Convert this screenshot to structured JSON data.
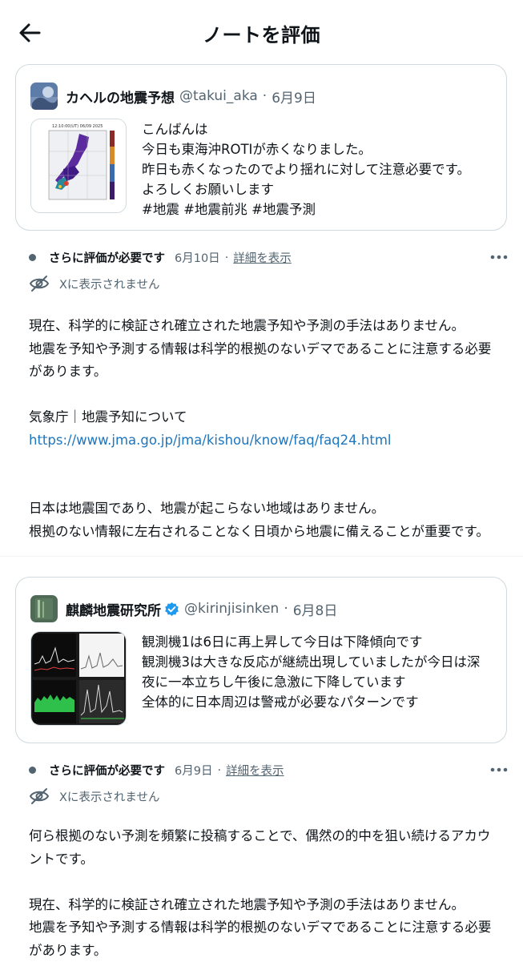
{
  "header": {
    "title": "ノートを評価"
  },
  "items": [
    {
      "tweet": {
        "name": "カヘルの地震予想",
        "handle": "@takui_aka",
        "date": "6月9日",
        "lines": [
          "こんばんは",
          "今日も東海沖ROTIが赤くなりました。",
          "昨日も赤くなったのでより揺れに対して注意必要です。",
          "よろしくお願いします",
          "#地震 #地震前兆 #地震予測"
        ],
        "thumb_lines": [
          "12:10:00(UT) 06/09 2025"
        ]
      },
      "note": {
        "status": "さらに評価が必要です",
        "date": "6月10日",
        "separator": "·",
        "details": "詳細を表示",
        "not_shown": "Xに表示されません",
        "body": [
          "現在、科学的に検証され確立された地震予知や予測の手法はありません。",
          "地震を予知や予測する情報は科学的根拠のないデマであることに注意する必要",
          "があります。",
          "",
          "気象庁｜地震予知について"
        ],
        "link": "https://www.jma.go.jp/jma/kishou/know/faq/faq24.html",
        "body2": [
          "日本は地震国であり、地震が起こらない地域はありません。",
          "根拠のない情報に左右されることなく日頃から地震に備えることが重要です。"
        ]
      }
    },
    {
      "tweet": {
        "name": "麒麟地震研究所",
        "handle": "@kirinjisinken",
        "date": "6月8日",
        "lines": [
          "観測機1は6日に再上昇して今日は下降傾向です",
          "観測機3は大きな反応が継続出現していましたが今日は深",
          "夜に一本立ちし午後に急激に下降しています",
          "全体的に日本周辺は警戒が必要なパターンです"
        ]
      },
      "note": {
        "status": "さらに評価が必要です",
        "date": "6月9日",
        "separator": "·",
        "details": "詳細を表示",
        "not_shown": "Xに表示されません",
        "body": [
          "何ら根拠のない予測を頻繁に投稿することで、偶然の的中を狙い続けるアカウ",
          "ントです。",
          "",
          "現在、科学的に検証され確立された地震予知や予測の手法はありません。",
          "地震を予知や予測する情報は科学的根拠のないデマであることに注意する必要",
          "があります。"
        ]
      }
    }
  ],
  "colors": {
    "muted": "#536471",
    "link": "#1d76bf",
    "border": "#cfd9de",
    "verified": "#1d9bf0"
  }
}
